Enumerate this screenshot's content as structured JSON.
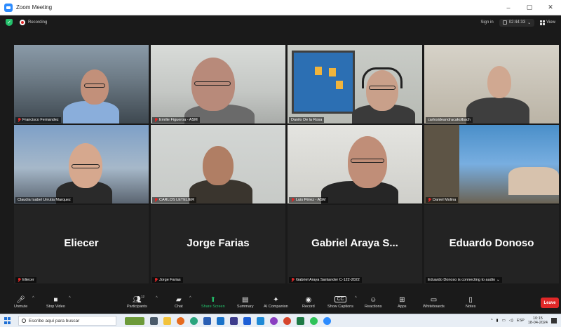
{
  "window": {
    "title": "Zoom Meeting",
    "minimize": "–",
    "maximize": "▢",
    "close": "✕"
  },
  "status": {
    "recording_label": "Recording",
    "sign_in": "Sign in",
    "timer": "02:44:33",
    "view_label": "View"
  },
  "participants": [
    {
      "name": "Francisco Fernandez",
      "muted": true,
      "video": true
    },
    {
      "name": "Emilie Figueroa - ASM",
      "muted": true,
      "video": true
    },
    {
      "name": "Danilo De la Rosa",
      "muted": false,
      "video": true,
      "active": true
    },
    {
      "name": "carlosideandracakolbach",
      "muted": false,
      "video": true
    },
    {
      "name": "Claudia Isabel Urrutia Marquez",
      "muted": false,
      "video": true
    },
    {
      "name": "CARLOS LETELIER",
      "muted": true,
      "video": true
    },
    {
      "name": "Luis Pérez - ASM",
      "muted": true,
      "video": true
    },
    {
      "name": "Daniel Molina",
      "muted": true,
      "video": true
    },
    {
      "display": "Eliecer",
      "name": "Eliecer",
      "muted": true,
      "video": false
    },
    {
      "display": "Jorge Farias",
      "name": "Jorge Farias",
      "muted": true,
      "video": false
    },
    {
      "display": "Gabriel Araya S...",
      "name": "Gabriel Araya Santander C-122-2022",
      "muted": true,
      "video": false
    },
    {
      "display": "Eduardo Donoso",
      "name": "Eduardo Donoso is connecting to audio",
      "muted": false,
      "video": false
    }
  ],
  "toolbar": {
    "unmute": "Unmute",
    "stop_video": "Stop Video",
    "participants": "Participants",
    "participants_count": "12",
    "chat": "Chat",
    "share_screen": "Share Screen",
    "summary": "Summary",
    "ai_companion": "AI Companion",
    "record": "Record",
    "show_captions": "Show Captions",
    "reactions": "Reactions",
    "apps": "Apps",
    "whiteboards": "Whiteboards",
    "notes": "Notes",
    "leave": "Leave"
  },
  "taskbar": {
    "search_placeholder": "Escribe aquí para buscar",
    "language": "ESP",
    "time": "10:15",
    "date": "18-04-2024"
  },
  "colors": {
    "accent_green": "#23c16b",
    "leave_red": "#e02828",
    "active_speaker": "#b5e356",
    "zoom_blue": "#2d8cff"
  }
}
